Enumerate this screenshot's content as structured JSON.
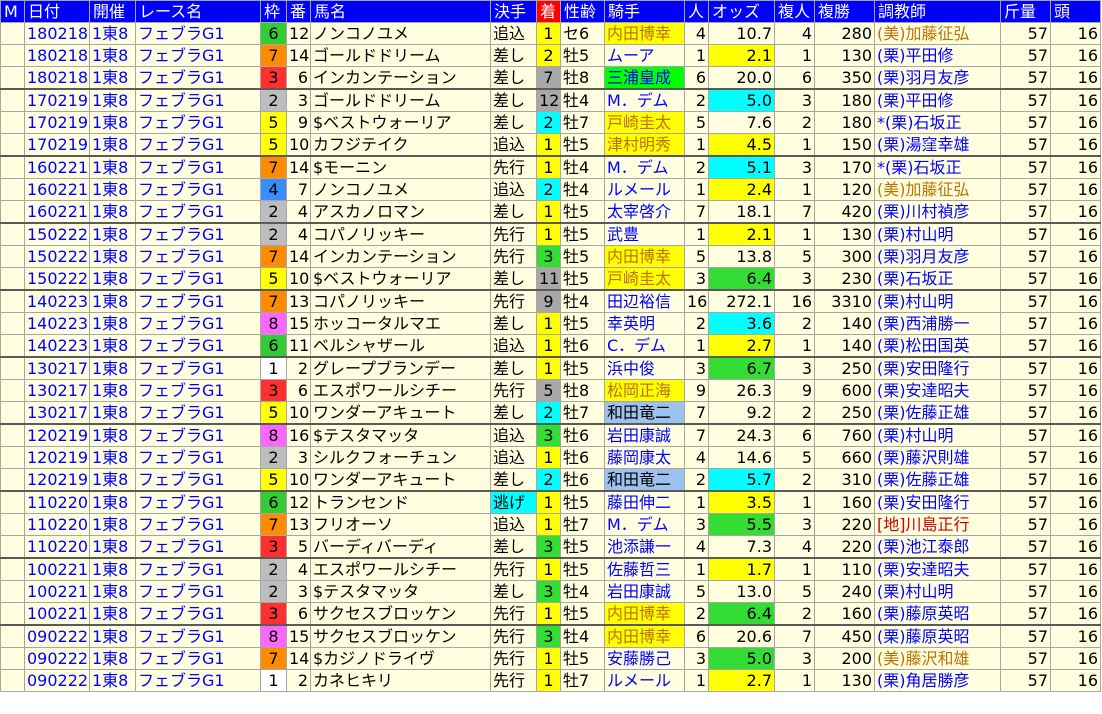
{
  "headers": [
    "M",
    "日付",
    "開催",
    "レース名",
    "枠",
    "番",
    "馬名",
    "決手",
    "着",
    "性齢",
    "騎手",
    "人",
    "オッズ",
    "複人",
    "複勝",
    "調教師",
    "斤量",
    "頭"
  ],
  "waku_colors": {
    "1": "#ffffff",
    "2": "#bdbdbd",
    "3": "#ff3030",
    "4": "#3a8cff",
    "5": "#ffff00",
    "6": "#33cc33",
    "7": "#ff8c00",
    "8": "#ff66ff"
  },
  "rows": [
    {
      "m": "",
      "date": "180218",
      "kaisai": "1東8",
      "race": "フェブラG1",
      "waku": "6",
      "ban": "12",
      "horse": "ノンコノユメ",
      "kimete": "追込",
      "chaku": "1",
      "seirei": "セ6",
      "jockey": "内田博幸",
      "ninki": "4",
      "odds": "10.7",
      "fukuninki": "4",
      "fukusho": "280",
      "trainer": "(美)加藤征弘",
      "kinryo": "57",
      "tou": "16",
      "chaku_hl": "yellow",
      "jockey_hl": "yellow",
      "odds_hl": "",
      "trainer_hl": "orange",
      "kimete_hl": "",
      "group_start": true
    },
    {
      "m": "",
      "date": "180218",
      "kaisai": "1東8",
      "race": "フェブラG1",
      "waku": "7",
      "ban": "14",
      "horse": "ゴールドドリーム",
      "kimete": "差し",
      "chaku": "2",
      "seirei": "牡5",
      "jockey": "ムーア",
      "ninki": "1",
      "odds": "2.1",
      "fukuninki": "1",
      "fukusho": "130",
      "trainer": "(栗)平田修",
      "kinryo": "57",
      "tou": "16",
      "chaku_hl": "yellow",
      "jockey_hl": "",
      "odds_hl": "yellow",
      "trainer_hl": "",
      "kimete_hl": "",
      "group_start": false
    },
    {
      "m": "",
      "date": "180218",
      "kaisai": "1東8",
      "race": "フェブラG1",
      "waku": "3",
      "ban": "6",
      "horse": "インカンテーション",
      "kimete": "差し",
      "chaku": "7",
      "seirei": "牡8",
      "jockey": "三浦皇成",
      "ninki": "6",
      "odds": "20.0",
      "fukuninki": "6",
      "fukusho": "350",
      "trainer": "(栗)羽月友彦",
      "kinryo": "57",
      "tou": "16",
      "chaku_hl": "gray",
      "jockey_hl": "green",
      "odds_hl": "",
      "trainer_hl": "",
      "kimete_hl": "",
      "group_start": false
    },
    {
      "m": "",
      "date": "170219",
      "kaisai": "1東8",
      "race": "フェブラG1",
      "waku": "2",
      "ban": "3",
      "horse": "ゴールドドリーム",
      "kimete": "差し",
      "chaku": "12",
      "seirei": "牡4",
      "jockey": "M．デム",
      "ninki": "2",
      "odds": "5.0",
      "fukuninki": "3",
      "fukusho": "180",
      "trainer": "(栗)平田修",
      "kinryo": "57",
      "tou": "16",
      "chaku_hl": "gray",
      "jockey_hl": "",
      "odds_hl": "cyan",
      "trainer_hl": "",
      "kimete_hl": "",
      "group_start": true
    },
    {
      "m": "",
      "date": "170219",
      "kaisai": "1東8",
      "race": "フェブラG1",
      "waku": "5",
      "ban": "9",
      "horse": "$ベストウォーリア",
      "kimete": "差し",
      "chaku": "2",
      "seirei": "牡7",
      "jockey": "戸崎圭太",
      "ninki": "5",
      "odds": "7.6",
      "fukuninki": "2",
      "fukusho": "180",
      "trainer": "*(栗)石坂正",
      "kinryo": "57",
      "tou": "16",
      "chaku_hl": "cyan",
      "jockey_hl": "yellow",
      "odds_hl": "",
      "trainer_hl": "",
      "kimete_hl": "",
      "group_start": false
    },
    {
      "m": "",
      "date": "170219",
      "kaisai": "1東8",
      "race": "フェブラG1",
      "waku": "5",
      "ban": "10",
      "horse": "カフジテイク",
      "kimete": "追込",
      "chaku": "1",
      "seirei": "牡5",
      "jockey": "津村明秀",
      "ninki": "1",
      "odds": "4.5",
      "fukuninki": "1",
      "fukusho": "150",
      "trainer": "(栗)湯窪幸雄",
      "kinryo": "57",
      "tou": "16",
      "chaku_hl": "yellow",
      "jockey_hl": "orange",
      "odds_hl": "yellow",
      "trainer_hl": "",
      "kimete_hl": "",
      "group_start": false
    },
    {
      "m": "",
      "date": "160221",
      "kaisai": "1東8",
      "race": "フェブラG1",
      "waku": "7",
      "ban": "14",
      "horse": "$モーニン",
      "kimete": "先行",
      "chaku": "1",
      "seirei": "牡4",
      "jockey": "M．デム",
      "ninki": "2",
      "odds": "5.1",
      "fukuninki": "3",
      "fukusho": "170",
      "trainer": "*(栗)石坂正",
      "kinryo": "57",
      "tou": "16",
      "chaku_hl": "yellow",
      "jockey_hl": "",
      "odds_hl": "cyan",
      "trainer_hl": "",
      "kimete_hl": "",
      "group_start": true
    },
    {
      "m": "",
      "date": "160221",
      "kaisai": "1東8",
      "race": "フェブラG1",
      "waku": "4",
      "ban": "7",
      "horse": "ノンコノユメ",
      "kimete": "追込",
      "chaku": "2",
      "seirei": "牡4",
      "jockey": "ルメール",
      "ninki": "1",
      "odds": "2.4",
      "fukuninki": "1",
      "fukusho": "120",
      "trainer": "(美)加藤征弘",
      "kinryo": "57",
      "tou": "16",
      "chaku_hl": "cyan",
      "jockey_hl": "",
      "odds_hl": "yellow",
      "trainer_hl": "orange",
      "kimete_hl": "",
      "group_start": false
    },
    {
      "m": "",
      "date": "160221",
      "kaisai": "1東8",
      "race": "フェブラG1",
      "waku": "2",
      "ban": "4",
      "horse": "アスカノロマン",
      "kimete": "差し",
      "chaku": "1",
      "seirei": "牡5",
      "jockey": "太宰啓介",
      "ninki": "7",
      "odds": "18.1",
      "fukuninki": "7",
      "fukusho": "420",
      "trainer": "(栗)川村禎彦",
      "kinryo": "57",
      "tou": "16",
      "chaku_hl": "yellow",
      "jockey_hl": "",
      "odds_hl": "",
      "trainer_hl": "",
      "kimete_hl": "",
      "group_start": false
    },
    {
      "m": "",
      "date": "150222",
      "kaisai": "1東8",
      "race": "フェブラG1",
      "waku": "2",
      "ban": "4",
      "horse": "コパノリッキー",
      "kimete": "先行",
      "chaku": "1",
      "seirei": "牡5",
      "jockey": "武豊",
      "ninki": "1",
      "odds": "2.1",
      "fukuninki": "1",
      "fukusho": "130",
      "trainer": "(栗)村山明",
      "kinryo": "57",
      "tou": "16",
      "chaku_hl": "yellow",
      "jockey_hl": "",
      "odds_hl": "yellow",
      "trainer_hl": "",
      "kimete_hl": "",
      "group_start": true
    },
    {
      "m": "",
      "date": "150222",
      "kaisai": "1東8",
      "race": "フェブラG1",
      "waku": "7",
      "ban": "14",
      "horse": "インカンテーション",
      "kimete": "先行",
      "chaku": "3",
      "seirei": "牡5",
      "jockey": "内田博幸",
      "ninki": "5",
      "odds": "13.8",
      "fukuninki": "5",
      "fukusho": "300",
      "trainer": "(栗)羽月友彦",
      "kinryo": "57",
      "tou": "16",
      "chaku_hl": "green",
      "jockey_hl": "yellow",
      "odds_hl": "",
      "trainer_hl": "",
      "kimete_hl": "",
      "group_start": false
    },
    {
      "m": "",
      "date": "150222",
      "kaisai": "1東8",
      "race": "フェブラG1",
      "waku": "5",
      "ban": "10",
      "horse": "$ベストウォーリア",
      "kimete": "差し",
      "chaku": "11",
      "seirei": "牡5",
      "jockey": "戸崎圭太",
      "ninki": "3",
      "odds": "6.4",
      "fukuninki": "3",
      "fukusho": "230",
      "trainer": "(栗)石坂正",
      "kinryo": "57",
      "tou": "16",
      "chaku_hl": "gray",
      "jockey_hl": "yellow",
      "odds_hl": "green",
      "trainer_hl": "",
      "kimete_hl": "",
      "group_start": false
    },
    {
      "m": "",
      "date": "140223",
      "kaisai": "1東8",
      "race": "フェブラG1",
      "waku": "7",
      "ban": "13",
      "horse": "コパノリッキー",
      "kimete": "先行",
      "chaku": "9",
      "seirei": "牡4",
      "jockey": "田辺裕信",
      "ninki": "16",
      "odds": "272.1",
      "fukuninki": "16",
      "fukusho": "3310",
      "trainer": "(栗)村山明",
      "kinryo": "57",
      "tou": "16",
      "chaku_hl": "gray",
      "jockey_hl": "",
      "odds_hl": "",
      "trainer_hl": "",
      "kimete_hl": "",
      "group_start": true
    },
    {
      "m": "",
      "date": "140223",
      "kaisai": "1東8",
      "race": "フェブラG1",
      "waku": "8",
      "ban": "15",
      "horse": "ホッコータルマエ",
      "kimete": "差し",
      "chaku": "1",
      "seirei": "牡5",
      "jockey": "幸英明",
      "ninki": "2",
      "odds": "3.6",
      "fukuninki": "2",
      "fukusho": "140",
      "trainer": "(栗)西浦勝一",
      "kinryo": "57",
      "tou": "16",
      "chaku_hl": "yellow",
      "jockey_hl": "",
      "odds_hl": "cyan",
      "trainer_hl": "",
      "kimete_hl": "",
      "group_start": false
    },
    {
      "m": "",
      "date": "140223",
      "kaisai": "1東8",
      "race": "フェブラG1",
      "waku": "6",
      "ban": "11",
      "horse": "ベルシャザール",
      "kimete": "追込",
      "chaku": "1",
      "seirei": "牡6",
      "jockey": "C．デム",
      "ninki": "1",
      "odds": "2.7",
      "fukuninki": "1",
      "fukusho": "140",
      "trainer": "(栗)松田国英",
      "kinryo": "57",
      "tou": "16",
      "chaku_hl": "yellow",
      "jockey_hl": "",
      "odds_hl": "yellow",
      "trainer_hl": "",
      "kimete_hl": "",
      "group_start": false
    },
    {
      "m": "",
      "date": "130217",
      "kaisai": "1東8",
      "race": "フェブラG1",
      "waku": "1",
      "ban": "2",
      "horse": "グレープブランデー",
      "kimete": "差し",
      "chaku": "1",
      "seirei": "牡5",
      "jockey": "浜中俊",
      "ninki": "3",
      "odds": "6.7",
      "fukuninki": "3",
      "fukusho": "250",
      "trainer": "(栗)安田隆行",
      "kinryo": "57",
      "tou": "16",
      "chaku_hl": "yellow",
      "jockey_hl": "",
      "odds_hl": "green",
      "trainer_hl": "",
      "kimete_hl": "",
      "group_start": true
    },
    {
      "m": "",
      "date": "130217",
      "kaisai": "1東8",
      "race": "フェブラG1",
      "waku": "3",
      "ban": "6",
      "horse": "エスポワールシチー",
      "kimete": "先行",
      "chaku": "5",
      "seirei": "牡8",
      "jockey": "松岡正海",
      "ninki": "9",
      "odds": "26.3",
      "fukuninki": "9",
      "fukusho": "600",
      "trainer": "(栗)安達昭夫",
      "kinryo": "57",
      "tou": "16",
      "chaku_hl": "gray",
      "jockey_hl": "yellow",
      "odds_hl": "",
      "trainer_hl": "",
      "kimete_hl": "",
      "group_start": false
    },
    {
      "m": "",
      "date": "130217",
      "kaisai": "1東8",
      "race": "フェブラG1",
      "waku": "5",
      "ban": "10",
      "horse": "ワンダーアキュート",
      "kimete": "差し",
      "chaku": "2",
      "seirei": "牡7",
      "jockey": "和田竜二",
      "ninki": "7",
      "odds": "9.2",
      "fukuninki": "2",
      "fukusho": "250",
      "trainer": "(栗)佐藤正雄",
      "kinryo": "57",
      "tou": "16",
      "chaku_hl": "cyan",
      "jockey_hl": "blue",
      "odds_hl": "",
      "trainer_hl": "",
      "kimete_hl": "",
      "group_start": false
    },
    {
      "m": "",
      "date": "120219",
      "kaisai": "1東8",
      "race": "フェブラG1",
      "waku": "8",
      "ban": "16",
      "horse": "$テスタマッタ",
      "kimete": "追込",
      "chaku": "3",
      "seirei": "牡6",
      "jockey": "岩田康誠",
      "ninki": "7",
      "odds": "24.3",
      "fukuninki": "6",
      "fukusho": "760",
      "trainer": "(栗)村山明",
      "kinryo": "57",
      "tou": "16",
      "chaku_hl": "green",
      "jockey_hl": "",
      "odds_hl": "",
      "trainer_hl": "",
      "kimete_hl": "",
      "group_start": true
    },
    {
      "m": "",
      "date": "120219",
      "kaisai": "1東8",
      "race": "フェブラG1",
      "waku": "2",
      "ban": "3",
      "horse": "シルクフォーチュン",
      "kimete": "追込",
      "chaku": "1",
      "seirei": "牡6",
      "jockey": "藤岡康太",
      "ninki": "4",
      "odds": "14.6",
      "fukuninki": "5",
      "fukusho": "660",
      "trainer": "(栗)藤沢則雄",
      "kinryo": "57",
      "tou": "16",
      "chaku_hl": "yellow",
      "jockey_hl": "",
      "odds_hl": "",
      "trainer_hl": "",
      "kimete_hl": "",
      "group_start": false
    },
    {
      "m": "",
      "date": "120219",
      "kaisai": "1東8",
      "race": "フェブラG1",
      "waku": "5",
      "ban": "10",
      "horse": "ワンダーアキュート",
      "kimete": "差し",
      "chaku": "2",
      "seirei": "牡6",
      "jockey": "和田竜二",
      "ninki": "2",
      "odds": "5.7",
      "fukuninki": "2",
      "fukusho": "310",
      "trainer": "(栗)佐藤正雄",
      "kinryo": "57",
      "tou": "16",
      "chaku_hl": "cyan",
      "jockey_hl": "blue",
      "odds_hl": "cyan",
      "trainer_hl": "",
      "kimete_hl": "",
      "group_start": false
    },
    {
      "m": "",
      "date": "110220",
      "kaisai": "1東8",
      "race": "フェブラG1",
      "waku": "6",
      "ban": "12",
      "horse": "トランセンド",
      "kimete": "逃げ",
      "chaku": "1",
      "seirei": "牡5",
      "jockey": "藤田伸二",
      "ninki": "1",
      "odds": "3.5",
      "fukuninki": "1",
      "fukusho": "160",
      "trainer": "(栗)安田隆行",
      "kinryo": "57",
      "tou": "16",
      "chaku_hl": "yellow",
      "jockey_hl": "",
      "odds_hl": "yellow",
      "trainer_hl": "",
      "kimete_hl": "cyan",
      "group_start": true
    },
    {
      "m": "",
      "date": "110220",
      "kaisai": "1東8",
      "race": "フェブラG1",
      "waku": "7",
      "ban": "13",
      "horse": "フリオーソ",
      "kimete": "追込",
      "chaku": "1",
      "seirei": "牡7",
      "jockey": "M．デム",
      "ninki": "3",
      "odds": "5.5",
      "fukuninki": "3",
      "fukusho": "220",
      "trainer": "[地]川島正行",
      "kinryo": "57",
      "tou": "16",
      "chaku_hl": "yellow",
      "jockey_hl": "",
      "odds_hl": "green",
      "trainer_hl": "red",
      "kimete_hl": "",
      "group_start": false
    },
    {
      "m": "",
      "date": "110220",
      "kaisai": "1東8",
      "race": "フェブラG1",
      "waku": "3",
      "ban": "5",
      "horse": "バーディバーディ",
      "kimete": "差し",
      "chaku": "3",
      "seirei": "牡5",
      "jockey": "池添謙一",
      "ninki": "4",
      "odds": "7.3",
      "fukuninki": "4",
      "fukusho": "220",
      "trainer": "(栗)池江泰郎",
      "kinryo": "57",
      "tou": "16",
      "chaku_hl": "green",
      "jockey_hl": "",
      "odds_hl": "",
      "trainer_hl": "",
      "kimete_hl": "",
      "group_start": false
    },
    {
      "m": "",
      "date": "100221",
      "kaisai": "1東8",
      "race": "フェブラG1",
      "waku": "2",
      "ban": "4",
      "horse": "エスポワールシチー",
      "kimete": "先行",
      "chaku": "1",
      "seirei": "牡5",
      "jockey": "佐藤哲三",
      "ninki": "1",
      "odds": "1.7",
      "fukuninki": "1",
      "fukusho": "110",
      "trainer": "(栗)安達昭夫",
      "kinryo": "57",
      "tou": "16",
      "chaku_hl": "yellow",
      "jockey_hl": "",
      "odds_hl": "yellow",
      "trainer_hl": "",
      "kimete_hl": "",
      "group_start": true
    },
    {
      "m": "",
      "date": "100221",
      "kaisai": "1東8",
      "race": "フェブラG1",
      "waku": "2",
      "ban": "3",
      "horse": "$テスタマッタ",
      "kimete": "差し",
      "chaku": "3",
      "seirei": "牡4",
      "jockey": "岩田康誠",
      "ninki": "5",
      "odds": "13.0",
      "fukuninki": "5",
      "fukusho": "240",
      "trainer": "(栗)村山明",
      "kinryo": "57",
      "tou": "16",
      "chaku_hl": "green",
      "jockey_hl": "",
      "odds_hl": "",
      "trainer_hl": "",
      "kimete_hl": "",
      "group_start": false
    },
    {
      "m": "",
      "date": "100221",
      "kaisai": "1東8",
      "race": "フェブラG1",
      "waku": "3",
      "ban": "6",
      "horse": "サクセスブロッケン",
      "kimete": "先行",
      "chaku": "1",
      "seirei": "牡5",
      "jockey": "内田博幸",
      "ninki": "2",
      "odds": "6.4",
      "fukuninki": "2",
      "fukusho": "160",
      "trainer": "(栗)藤原英昭",
      "kinryo": "57",
      "tou": "16",
      "chaku_hl": "yellow",
      "jockey_hl": "yellow",
      "odds_hl": "green",
      "trainer_hl": "",
      "kimete_hl": "",
      "group_start": false
    },
    {
      "m": "",
      "date": "090222",
      "kaisai": "1東8",
      "race": "フェブラG1",
      "waku": "8",
      "ban": "15",
      "horse": "サクセスブロッケン",
      "kimete": "先行",
      "chaku": "3",
      "seirei": "牡4",
      "jockey": "内田博幸",
      "ninki": "6",
      "odds": "20.6",
      "fukuninki": "7",
      "fukusho": "450",
      "trainer": "(栗)藤原英昭",
      "kinryo": "57",
      "tou": "16",
      "chaku_hl": "green",
      "jockey_hl": "yellow",
      "odds_hl": "",
      "trainer_hl": "",
      "kimete_hl": "",
      "group_start": true
    },
    {
      "m": "",
      "date": "090222",
      "kaisai": "1東8",
      "race": "フェブラG1",
      "waku": "7",
      "ban": "14",
      "horse": "$カジノドライヴ",
      "kimete": "先行",
      "chaku": "1",
      "seirei": "牡5",
      "jockey": "安藤勝己",
      "ninki": "3",
      "odds": "5.0",
      "fukuninki": "3",
      "fukusho": "200",
      "trainer": "(美)藤沢和雄",
      "kinryo": "57",
      "tou": "16",
      "chaku_hl": "yellow",
      "jockey_hl": "",
      "odds_hl": "green",
      "trainer_hl": "orange",
      "kimete_hl": "",
      "group_start": false
    },
    {
      "m": "",
      "date": "090222",
      "kaisai": "1東8",
      "race": "フェブラG1",
      "waku": "1",
      "ban": "2",
      "horse": "カネヒキリ",
      "kimete": "先行",
      "chaku": "1",
      "seirei": "牡7",
      "jockey": "ルメール",
      "ninki": "1",
      "odds": "2.7",
      "fukuninki": "1",
      "fukusho": "130",
      "trainer": "(栗)角居勝彦",
      "kinryo": "57",
      "tou": "16",
      "chaku_hl": "yellow",
      "jockey_hl": "",
      "odds_hl": "yellow",
      "trainer_hl": "",
      "kimete_hl": "",
      "group_start": false
    }
  ]
}
